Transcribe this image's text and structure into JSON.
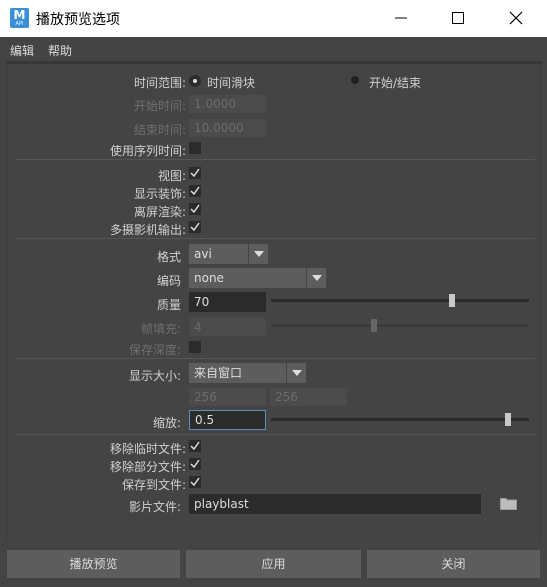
{
  "window": {
    "title": "播放预览选项",
    "app_icon_letter": "M",
    "app_icon_sub": "API"
  },
  "menu": {
    "edit": "编辑",
    "help": "帮助"
  },
  "time": {
    "range_label": "时间范围:",
    "opt_slider": "时间滑块",
    "opt_startend": "开始/结束",
    "start_label": "开始时间:",
    "start_value": "1.0000",
    "end_label": "结束时间:",
    "end_value": "10.0000",
    "use_seq_label": "使用序列时间:"
  },
  "view": {
    "view_label": "视图:",
    "decor_label": "显示装饰:",
    "offscreen_label": "离屏渲染:",
    "multicam_label": "多摄影机输出:"
  },
  "encoding": {
    "format_label": "格式",
    "format_value": "avi",
    "codec_label": "编码",
    "codec_value": "none",
    "quality_label": "质量",
    "quality_value": "70",
    "quality_level": 0.7,
    "padding_label": "帧填充:",
    "padding_value": "4",
    "padding_level": 0.4,
    "depth_label": "保存深度:"
  },
  "display": {
    "size_label": "显示大小:",
    "size_value": "来自窗口",
    "width_value": "256",
    "height_value": "256",
    "scale_label": "缩放:",
    "scale_value": "0.5",
    "scale_level": 0.92
  },
  "files": {
    "remove_temp_label": "移除临时文件:",
    "remove_partial_label": "移除部分文件:",
    "save_to_file_label": "保存到文件:",
    "movie_file_label": "影片文件:",
    "movie_file_value": "playblast"
  },
  "buttons": {
    "playblast": "播放预览",
    "apply": "应用",
    "close": "关闭"
  },
  "colors": {
    "panel_bg": "#444444",
    "field_bg": "#2b2b2b",
    "button_bg": "#5d5d5d",
    "focus": "#5d8fc7",
    "app_icon": "#3a8fd8"
  }
}
